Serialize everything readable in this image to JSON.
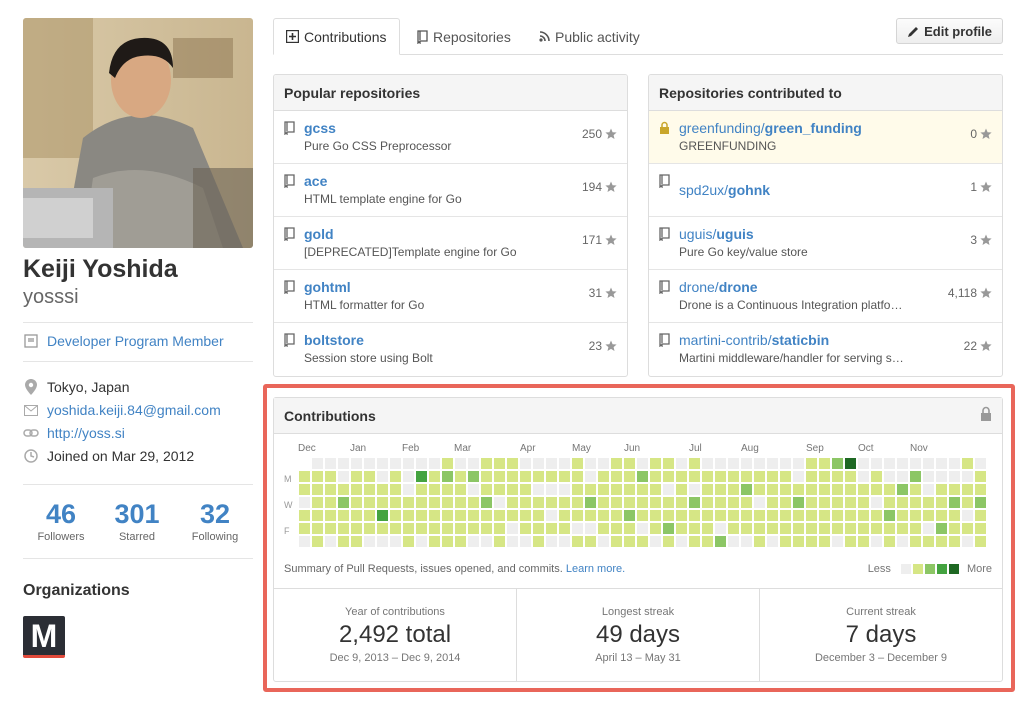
{
  "profile": {
    "fullname": "Keiji Yoshida",
    "username": "yosssi",
    "badge": "Developer Program Member",
    "location": "Tokyo, Japan",
    "email": "yoshida.keiji.84@gmail.com",
    "website": "http://yoss.si",
    "joined": "Joined on Mar 29, 2012",
    "stats": [
      {
        "value": "46",
        "label": "Followers"
      },
      {
        "value": "301",
        "label": "Starred"
      },
      {
        "value": "32",
        "label": "Following"
      }
    ],
    "organizations_title": "Organizations",
    "org_letter": "M"
  },
  "tabs": [
    {
      "label": "Contributions",
      "icon": "plus-square-icon",
      "active": true
    },
    {
      "label": "Repositories",
      "icon": "repo-icon",
      "active": false
    },
    {
      "label": "Public activity",
      "icon": "rss-icon",
      "active": false
    }
  ],
  "edit_profile_label": "Edit profile",
  "popular": {
    "title": "Popular repositories",
    "repos": [
      {
        "name": "gcss",
        "desc": "Pure Go CSS Preprocessor",
        "stars": "250"
      },
      {
        "name": "ace",
        "desc": "HTML template engine for Go",
        "stars": "194"
      },
      {
        "name": "gold",
        "desc": "[DEPRECATED]Template engine for Go",
        "stars": "171"
      },
      {
        "name": "gohtml",
        "desc": "HTML formatter for Go",
        "stars": "31"
      },
      {
        "name": "boltstore",
        "desc": "Session store using Bolt",
        "stars": "23"
      }
    ]
  },
  "contributed": {
    "title": "Repositories contributed to",
    "repos": [
      {
        "owner": "greenfunding/",
        "name": "green_funding",
        "desc": "GREENFUNDING",
        "stars": "0",
        "private": true
      },
      {
        "owner": "spd2ux/",
        "name": "gohnk",
        "desc": "",
        "stars": "1",
        "private": false
      },
      {
        "owner": "uguis/",
        "name": "uguis",
        "desc": "Pure Go key/value store",
        "stars": "3",
        "private": false
      },
      {
        "owner": "drone/",
        "name": "drone",
        "desc": "Drone is a Continuous Integration platform buil…",
        "stars": "4,118",
        "private": false
      },
      {
        "owner": "martini-contrib/",
        "name": "staticbin",
        "desc": "Martini middleware/handler for serving static fil…",
        "stars": "22",
        "private": false
      }
    ]
  },
  "contributions": {
    "title": "Contributions",
    "months": [
      "Dec",
      "Jan",
      "Feb",
      "Mar",
      "Apr",
      "May",
      "Jun",
      "Jul",
      "Aug",
      "Sep",
      "Oct",
      "Nov"
    ],
    "days": [
      "M",
      "W",
      "F"
    ],
    "summary": "Summary of Pull Requests, issues opened, and commits.",
    "learn_more": "Learn more.",
    "legend_less": "Less",
    "legend_more": "More",
    "colors": [
      "#eeeeee",
      "#d6e685",
      "#8cc665",
      "#44a340",
      "#1e6823"
    ],
    "stats": [
      {
        "label": "Year of contributions",
        "value": "2,492 total",
        "range": "Dec 9, 2013 – Dec 9, 2014"
      },
      {
        "label": "Longest streak",
        "value": "49 days",
        "range": "April 13 – May 31"
      },
      {
        "label": "Current streak",
        "value": "7 days",
        "range": "December 3 – December 9"
      }
    ]
  }
}
